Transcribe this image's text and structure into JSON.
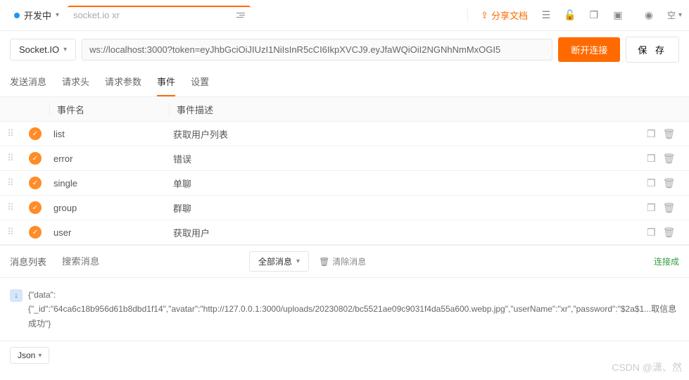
{
  "top": {
    "status_label": "开发中",
    "tab_name": "socket.io xr",
    "share_label": "分享文档",
    "space_label": "空"
  },
  "url": {
    "protocol": "Socket.IO",
    "value": "ws://localhost:3000?token=eyJhbGciOiJIUzI1NiIsInR5cCI6IkpXVCJ9.eyJfaWQiOiI2NGNhNmMxOGI5",
    "disconnect_label": "断开连接",
    "save_label": "保 存"
  },
  "sub_tabs": {
    "send": "发送消息",
    "headers": "请求头",
    "params": "请求参数",
    "events": "事件",
    "settings": "设置",
    "active": "events"
  },
  "events": {
    "header_name": "事件名",
    "header_desc": "事件描述",
    "rows": [
      {
        "name": "list",
        "desc": "获取用户列表"
      },
      {
        "name": "error",
        "desc": "错误"
      },
      {
        "name": "single",
        "desc": "单聊"
      },
      {
        "name": "group",
        "desc": "群聊"
      },
      {
        "name": "user",
        "desc": "获取用户"
      }
    ]
  },
  "messages": {
    "title": "消息列表",
    "search_placeholder": "搜索消息",
    "filter_label": "全部消息",
    "clear_label": "清除消息",
    "status": "连接成",
    "body_line1": "{\"data\":",
    "body_line2": "{\"_id\":\"64ca6c18b956d61b8dbd1f14\",\"avatar\":\"http://127.0.0.1:3000/uploads/20230802/bc5521ae09c9031f4da55a600.webp.jpg\",\"userName\":\"xr\",\"password\":\"$2a$1...取信息成功\"}"
  },
  "bottom": {
    "format": "Json"
  },
  "watermark": "CSDN @潇、然"
}
